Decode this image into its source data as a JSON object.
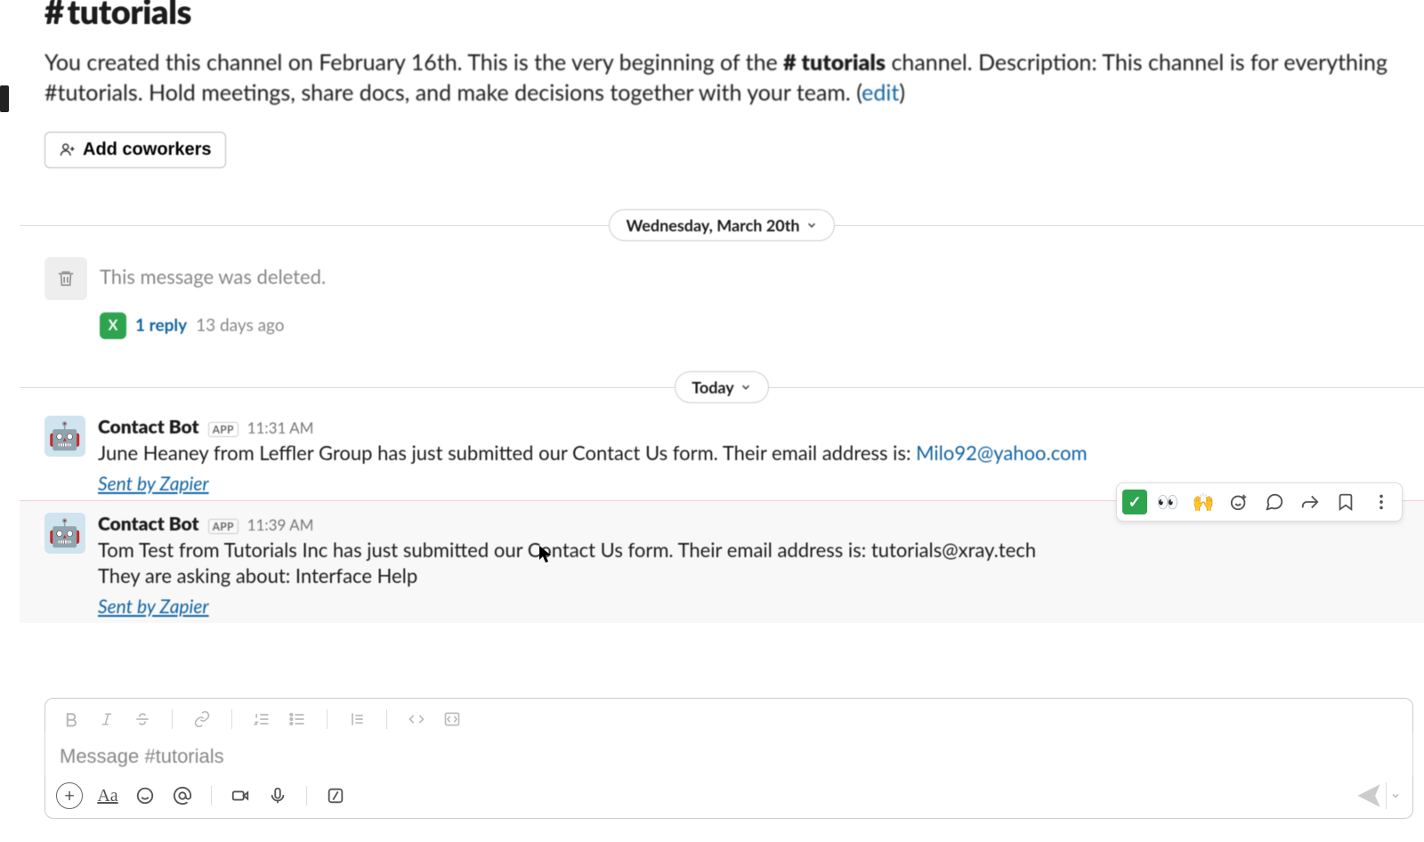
{
  "channel": {
    "hash": "#",
    "name": "tutorials"
  },
  "intro": {
    "text_before": "You created this channel on February 16th. This is the very beginning of the ",
    "channel_ref": "# tutorials",
    "text_after": " channel. Description: This channel is for everything #tutorials. Hold meetings, share docs, and make decisions together with your team. (",
    "edit": "edit",
    "close_paren": ")"
  },
  "add_coworkers": "Add coworkers",
  "dividers": {
    "day1": "Wednesday, March 20th",
    "day2": "Today"
  },
  "deleted": {
    "text": "This message was deleted.",
    "avatar_letter": "X",
    "reply_count": "1 reply",
    "reply_age": "13 days ago"
  },
  "messages": [
    {
      "author": "Contact Bot",
      "badge": "APP",
      "time": "11:31 AM",
      "body_before_link": "June Heaney from Leffler Group has just submitted our Contact Us form.  Their email address is: ",
      "link_text": "Milo92@yahoo.com",
      "body_after_link": "",
      "sent_by": "Sent by Zapier"
    },
    {
      "author": "Contact Bot",
      "badge": "APP",
      "time": "11:39 AM",
      "body_line1": "Tom Test from Tutorials Inc has just submitted our Contact Us form.  Their email address is: tutorials@xray.tech",
      "body_line2": "They are asking about: Interface Help",
      "sent_by": "Sent by Zapier"
    }
  ],
  "hover_toolbar": {
    "check": "✓",
    "eyes": "👀",
    "hands": "🙌"
  },
  "composer": {
    "placeholder": "Message #tutorials",
    "aa": "Aa"
  }
}
